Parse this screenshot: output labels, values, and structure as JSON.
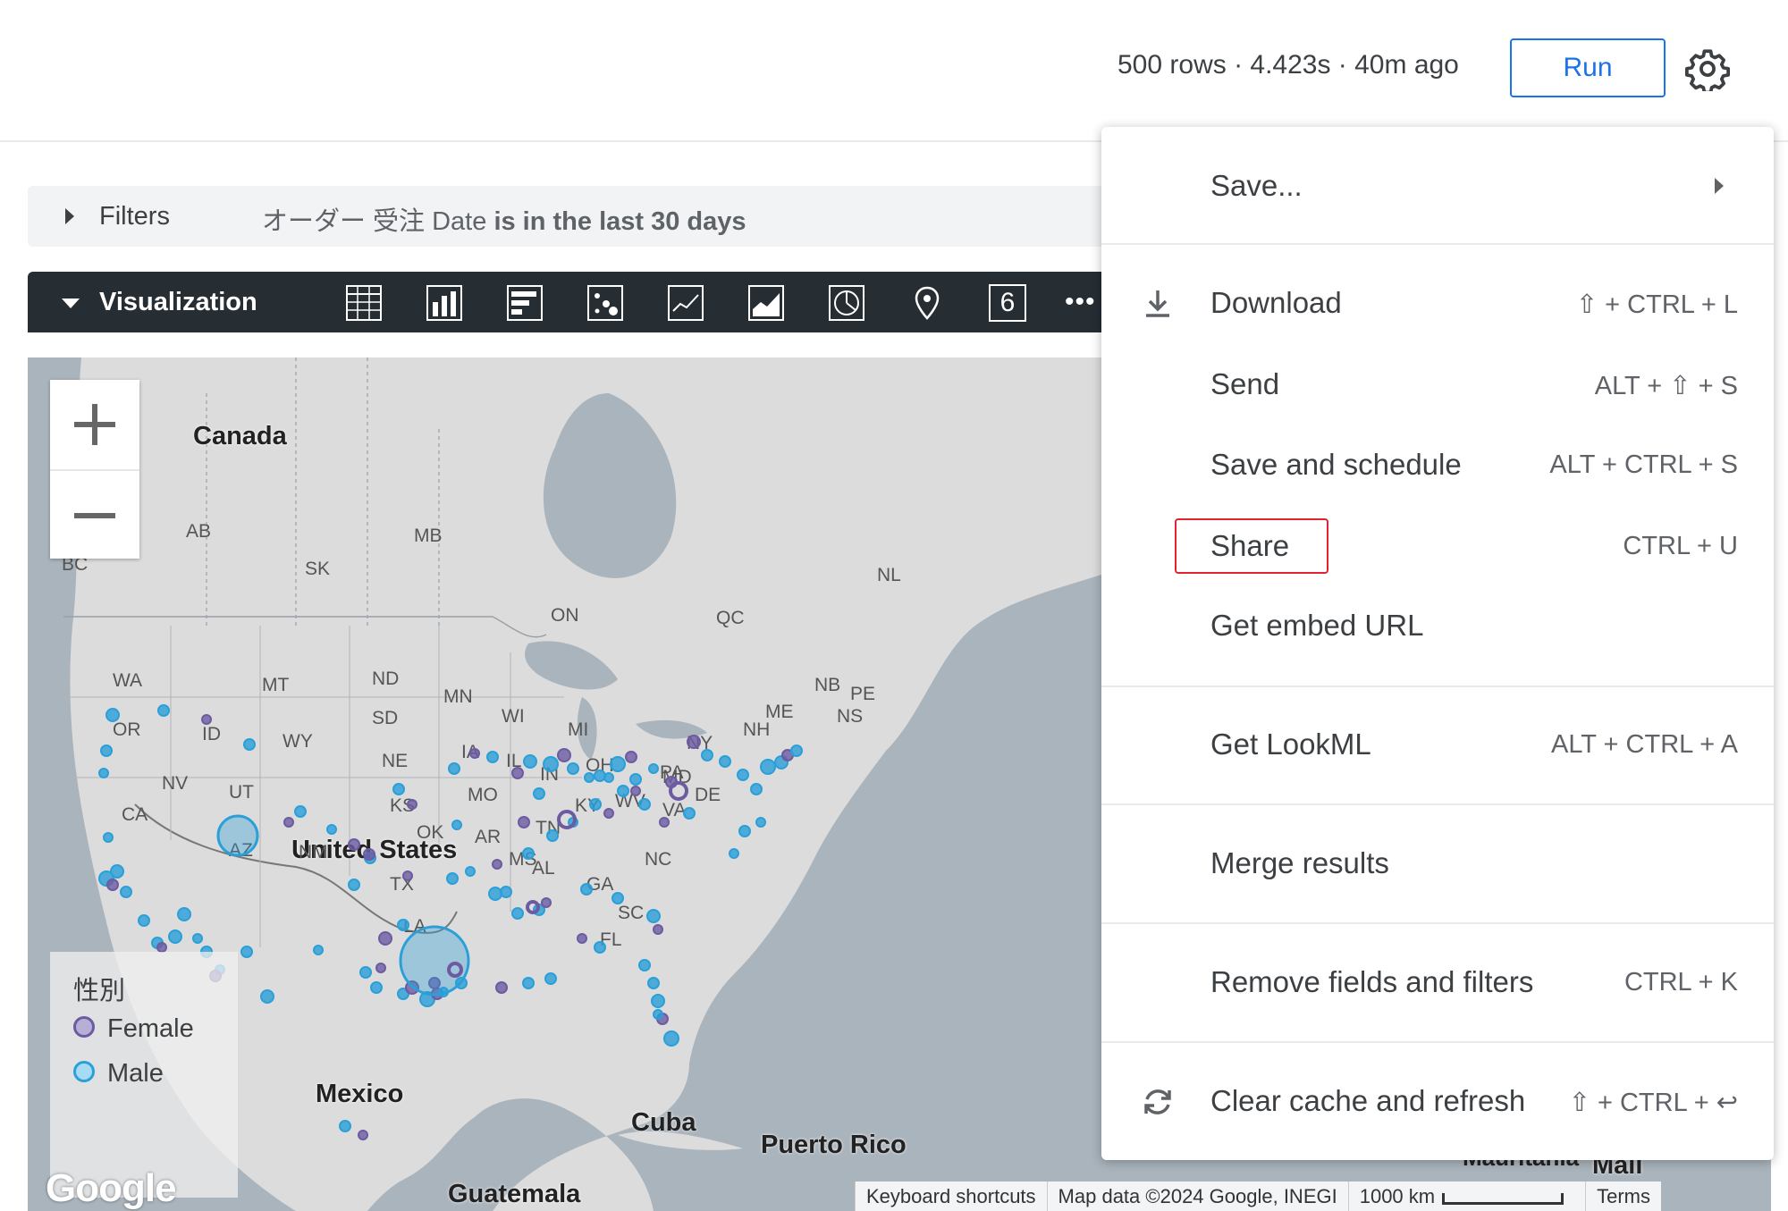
{
  "header": {
    "meta": "500 rows · 4.423s · 40m ago",
    "run_label": "Run",
    "settings_icon": "gear-icon"
  },
  "filters": {
    "label": "Filters",
    "expr_field": "オーダー 受注 Date",
    "expr_condition": "is in the last 30 days"
  },
  "visualization": {
    "label": "Visualization",
    "types": [
      "table-icon",
      "column-chart-icon",
      "bar-chart-icon",
      "scatter-icon",
      "line-chart-icon",
      "area-chart-icon",
      "pie-chart-icon",
      "map-pin-icon",
      "single-value-icon",
      "more-icon"
    ],
    "single_value_glyph": "6",
    "more_glyph": "•••"
  },
  "map": {
    "country_labels": [
      "Canada",
      "United States",
      "Mexico",
      "Cuba",
      "Puerto Rico",
      "Guatemala",
      "Mali"
    ],
    "country_label_mauritania": "Mauritania",
    "region_labels": [
      "AB",
      "BC",
      "SK",
      "MB",
      "ON",
      "QC",
      "NL",
      "NB",
      "PE",
      "NS",
      "WA",
      "OR",
      "ID",
      "MT",
      "WY",
      "ND",
      "SD",
      "NE",
      "NV",
      "UT",
      "CA",
      "AZ",
      "NM",
      "TX",
      "OK",
      "KS",
      "MN",
      "WI",
      "IA",
      "IL",
      "MO",
      "AR",
      "MS",
      "AL",
      "GA",
      "TN",
      "KY",
      "IN",
      "OH",
      "MI",
      "PA",
      "NY",
      "ME",
      "NH",
      "WV",
      "VA",
      "MD",
      "DE",
      "NC",
      "SC",
      "FL",
      "LA"
    ],
    "legend": {
      "title": "性別",
      "items": [
        {
          "label": "Female",
          "color": "#6d5ba1"
        },
        {
          "label": "Male",
          "color": "#2a9fd8"
        }
      ]
    },
    "google_logo": "Google",
    "footer": {
      "shortcuts": "Keyboard shortcuts",
      "attribution": "Map data ©2024 Google, INEGI",
      "scale": "1000 km",
      "terms": "Terms"
    },
    "zoom_in_icon": "plus-icon",
    "zoom_out_icon": "minus-icon"
  },
  "menu": {
    "save": "Save...",
    "download": {
      "label": "Download",
      "shortcut": "⇧ + CTRL + L"
    },
    "send": {
      "label": "Send",
      "shortcut": "ALT + ⇧ + S"
    },
    "save_schedule": {
      "label": "Save and schedule",
      "shortcut": "ALT + CTRL + S"
    },
    "share": {
      "label": "Share",
      "shortcut": "CTRL + U"
    },
    "embed": {
      "label": "Get embed URL"
    },
    "lookml": {
      "label": "Get LookML",
      "shortcut": "ALT + CTRL + A"
    },
    "merge": {
      "label": "Merge results"
    },
    "remove": {
      "label": "Remove fields and filters",
      "shortcut": "CTRL + K"
    },
    "clear": {
      "label": "Clear cache and refresh",
      "shortcut": "⇧ + CTRL + ↩"
    }
  }
}
